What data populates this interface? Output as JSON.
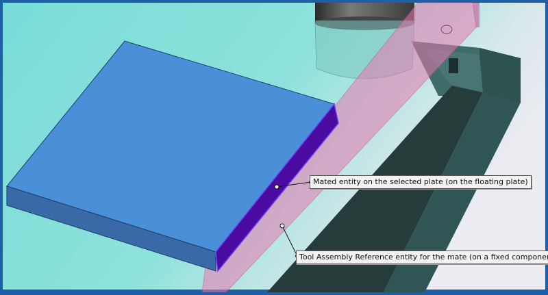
{
  "viewport": {
    "background_gradient": [
      "#7adcd8",
      "#e6e6ec"
    ],
    "frame_color": "#1f5fa8"
  },
  "scene": {
    "plate_top_color": "#4a90d9",
    "plate_front_color": "#3a69a8",
    "mated_face_color": "#4b0aa0",
    "reference_plane_color": "#e87ab0",
    "fixture_color": "#2e4d4b",
    "cylinder_color": "#5a5a5a"
  },
  "callouts": [
    {
      "id": "mated-entity",
      "text": "Mated entity on the selected plate (on the floating plate)"
    },
    {
      "id": "tool-reference",
      "text": "Tool Assembly Reference entity for the mate (on a fixed component)"
    }
  ]
}
